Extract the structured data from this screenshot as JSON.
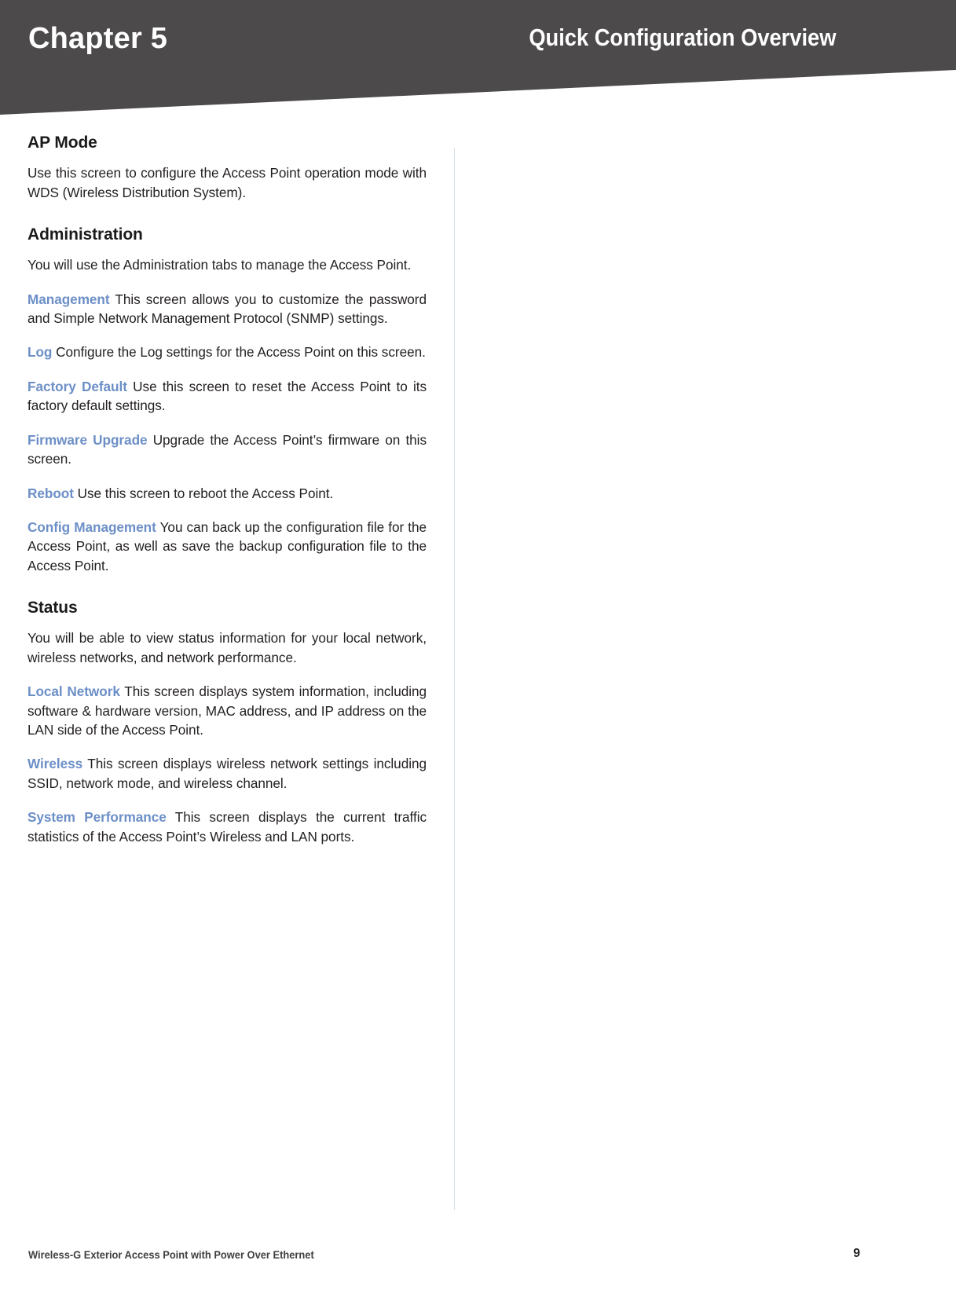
{
  "header": {
    "chapter_label": "Chapter 5",
    "title": "Quick Configuration Overview",
    "background_color": "#4c4a4b",
    "text_color": "#ffffff"
  },
  "document": {
    "term_color": "#6c8fc7",
    "body_text_color": "#231f20"
  },
  "sections": [
    {
      "heading": "AP Mode",
      "paragraphs": [
        {
          "term": "",
          "text": "Use this screen to configure the Access Point operation mode with WDS (Wireless Distribution System)."
        }
      ]
    },
    {
      "heading": "Administration",
      "paragraphs": [
        {
          "term": "",
          "text": "You will use the Administration tabs to manage the Access Point."
        },
        {
          "term": "Management",
          "text": "This screen allows you to customize the password and Simple Network Management Protocol (SNMP) settings."
        },
        {
          "term": "Log",
          "text": "Configure the Log settings for the Access Point on this screen."
        },
        {
          "term": "Factory Default",
          "text": "Use this screen to reset the Access Point to its factory default settings."
        },
        {
          "term": "Firmware Upgrade",
          "text": "Upgrade the Access Point’s firmware on this screen."
        },
        {
          "term": "Reboot",
          "text": "Use this screen to reboot the Access Point."
        },
        {
          "term": "Config Management",
          "text": "You can back up the configuration file for the Access Point, as well as save the backup configuration file to the Access Point."
        }
      ]
    },
    {
      "heading": "Status",
      "paragraphs": [
        {
          "term": "",
          "text": "You will be able to view status information for your local network, wireless networks, and network performance."
        },
        {
          "term": "Local Network",
          "text": "This screen displays system information, including software & hardware version, MAC address, and IP address on the LAN side of the Access Point."
        },
        {
          "term": "Wireless",
          "text": "This screen displays wireless network settings including SSID, network mode, and wireless channel."
        },
        {
          "term": "System Performance",
          "text": "This screen displays the current traffic statistics of the Access Point’s Wireless and LAN ports."
        }
      ]
    }
  ],
  "footer": {
    "product_name": "Wireless-G Exterior Access Point with Power Over Ethernet",
    "page_number": "9"
  }
}
